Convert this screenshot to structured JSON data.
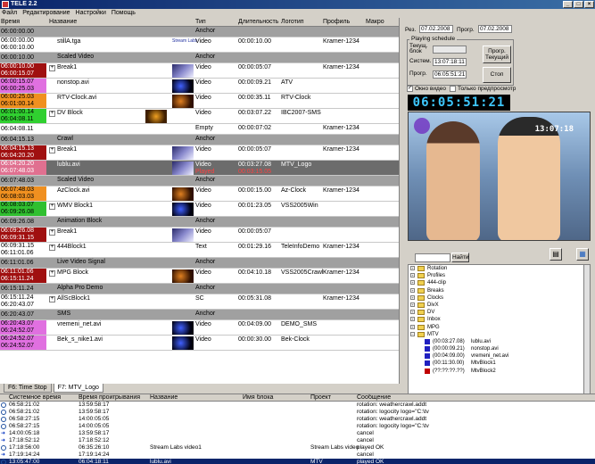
{
  "window": {
    "title": "TELE 2.2",
    "controls": [
      "_",
      "□",
      "×"
    ]
  },
  "menu": [
    "Файл",
    "Редактирование",
    "Настройки",
    "Помощь"
  ],
  "grid": {
    "headers": {
      "time": "Время",
      "name": "Название",
      "type": "Тип",
      "duration": "Длительность",
      "logo": "Логотип",
      "profile": "Профиль",
      "macro": "Макро"
    },
    "rows": [
      {
        "time": "06:00:00.00",
        "name": "",
        "type": "Anchor",
        "dur": "",
        "logo": "",
        "prof": "",
        "kind": "grp",
        "color": "#a0a0a0"
      },
      {
        "time": "06:00:00.00",
        "time2": "06:00:10.00",
        "name": "stillA.tga",
        "type": "Video",
        "dur": "00:00:10.00",
        "logo": "",
        "prof": "Kramer-1234",
        "color": "#ffffff",
        "thumb": "stream",
        "thumb_text": "Stream Labs",
        "tall": true
      },
      {
        "time": "06:00:10.00",
        "name": "Scaled Video",
        "type": "Anchor",
        "kind": "grp",
        "color": "#a0a0a0"
      },
      {
        "time": "06:00:10.00",
        "time2": "06:00:15.07",
        "name": "Break1",
        "type": "Video",
        "dur": "00:00:05:07",
        "logo": "",
        "prof": "Kramer-1234",
        "color": "#a01010",
        "thumb": "plain",
        "plus": true,
        "tall": true
      },
      {
        "time": "06:00:15.07",
        "time2": "06:00:25.03",
        "name": "nonstop.avi",
        "type": "Video",
        "dur": "00:00:09.21",
        "logo": "ATV",
        "prof": "",
        "color": "#e070e0",
        "thumb": "space",
        "tall": true
      },
      {
        "time": "06:00:25.03",
        "time2": "06:01:00.14",
        "name": "RTV-Clock.avi",
        "type": "Video",
        "dur": "00:00:35.11",
        "logo": "RTV-Clock",
        "prof": "",
        "color": "#f09020",
        "thumb": "dark",
        "tall": true
      },
      {
        "time": "06:01:00.14",
        "time2": "06:04:08.11",
        "name": "DV Block",
        "type": "Video",
        "dur": "00:03:07.22",
        "logo": "IBC2007-SMS",
        "prof": "",
        "color": "#30d030",
        "thumb": "fire",
        "plus": true,
        "tall": true
      },
      {
        "time": "06:04:08.11",
        "name": "",
        "type": "Empty",
        "dur": "00:00:07:02",
        "logo": "",
        "prof": "Kramer-1234",
        "color": "#ffffff"
      },
      {
        "time": "06:04:15.13",
        "name": "Crawl",
        "type": "Anchor",
        "kind": "grp",
        "color": "#a0a0a0"
      },
      {
        "time": "06:04:15.13",
        "time2": "06:04:20.20",
        "name": "Break1",
        "type": "Video",
        "dur": "00:00:05:07",
        "logo": "",
        "prof": "Kramer-1234",
        "color": "#a01010",
        "thumb": "plain",
        "plus": true,
        "tall": true
      },
      {
        "time": "06:04:20.20",
        "time2": "06:07:48.03",
        "name": "lublu.avi",
        "type": "Video",
        "dur": "00:03:27.08",
        "logo": "MTV_Logo",
        "prof": "",
        "color": "#e07090",
        "thumb": "plain",
        "kind": "sel",
        "tall": true,
        "sub": "Played",
        "sub2": "00:03:15.05"
      },
      {
        "time": "06:07:48.03",
        "name": "Scaled Video",
        "type": "Anchor",
        "kind": "grp",
        "color": "#a0a0a0"
      },
      {
        "time": "06:07:48.03",
        "time2": "06:08:03.03",
        "name": "AzClock.avi",
        "type": "Video",
        "dur": "00:00:15.00",
        "logo": "Az-Clock",
        "prof": "Kramer-1234",
        "color": "#f09020",
        "thumb": "dark",
        "tall": true
      },
      {
        "time": "06:08:03.07",
        "time2": "06:09:26.08",
        "name": "WMV Block1",
        "type": "Video",
        "dur": "00:01:23.05",
        "logo": "VSS2005Win",
        "prof": "",
        "color": "#30c030",
        "thumb": "space",
        "plus": true,
        "tall": true
      },
      {
        "time": "06:09:26.08",
        "name": "Animation Block",
        "type": "Anchor",
        "kind": "grp",
        "color": "#a0a0a0"
      },
      {
        "time": "06:09:26.08",
        "time2": "06:09:31.15",
        "name": "Break1",
        "type": "Video",
        "dur": "00:00:05:07",
        "logo": "",
        "prof": "",
        "color": "#a01010",
        "thumb": "plain",
        "plus": true,
        "tall": true
      },
      {
        "time": "06:09:31.15",
        "time2": "06:11:01.06",
        "name": "444Block1",
        "type": "Text",
        "dur": "00:01:29.16",
        "logo": "TeleInfoDemo",
        "prof": "Kramer-1234",
        "color": "#ffffff",
        "plus": true,
        "tall": true
      },
      {
        "time": "06:11:01.06",
        "name": "Live Video Signal",
        "type": "Anchor",
        "kind": "grp",
        "color": "#a0a0a0"
      },
      {
        "time": "06:11:01.06",
        "time2": "06:15:11.24",
        "name": "MPG Block",
        "type": "Video",
        "dur": "00:04:10.18",
        "logo": "VSS2005Crawl",
        "prof": "Kramer-1234",
        "color": "#a01010",
        "thumb": "dark",
        "plus": true,
        "tall": true
      },
      {
        "time": "06:15:11.24",
        "name": "Alpha Pro Demo",
        "type": "Anchor",
        "kind": "grp",
        "color": "#a0a0a0"
      },
      {
        "time": "06:15:11.24",
        "time2": "06:20:43.07",
        "name": "AllScBlock1",
        "type": "SC",
        "dur": "00:05:31.08",
        "logo": "",
        "prof": "Kramer-1234",
        "color": "#ffffff",
        "plus": true,
        "tall": true
      },
      {
        "time": "06:20:43.07",
        "name": "SMS",
        "type": "Anchor",
        "kind": "grp",
        "color": "#a0a0a0"
      },
      {
        "time": "06:20:43.07",
        "time2": "06:24:52.07",
        "name": "vremeni_net.avi",
        "type": "Video",
        "dur": "00:04:09.00",
        "logo": "DEMO_SMS",
        "prof": "",
        "color": "#e070e0",
        "thumb": "space",
        "tall": true
      },
      {
        "time": "06:24:52.07",
        "time2": "06:24:52.07",
        "name": "Bek_s_nike1.avi",
        "type": "Video",
        "dur": "00:00:30.00",
        "logo": "Bek-Clock",
        "prof": "",
        "color": "#e070e0",
        "thumb": "space",
        "tall": true
      }
    ]
  },
  "grid_tabs": [
    {
      "label": "F6:  Time Stop",
      "active": false
    },
    {
      "label": "F7:  MTV_Logo",
      "active": true
    }
  ],
  "right": {
    "rec_label": "Рез.",
    "rec_date": "07.02.2008",
    "prog_label": "Прогр.",
    "prog_date": "07.02.2008",
    "schedule_title": "Playing schedule",
    "current_block_label": "Текущ. блок",
    "system_label": "Систем.",
    "system_time": "13:07:18:11",
    "prog_time_label": "Прогр.",
    "prog_time": "06:05:51:21",
    "prog_current_btn": "Прогр. Текущий",
    "stop_btn": "Стоп",
    "video_window_label": "Окно видео",
    "preview_only_label": "Только предпросмотр",
    "clock": "06:05:51:21",
    "preview_stamp": "13:07:18",
    "search_btn": "Найти"
  },
  "tree": [
    {
      "type": "folder",
      "label": "Rotation"
    },
    {
      "type": "folder",
      "label": "Profiles"
    },
    {
      "type": "folder",
      "label": "444-clip"
    },
    {
      "type": "folder",
      "label": "Breaks"
    },
    {
      "type": "folder",
      "label": "Clocks"
    },
    {
      "type": "folder",
      "label": "DivX"
    },
    {
      "type": "folder",
      "label": "DV"
    },
    {
      "type": "folder",
      "label": "Inbox"
    },
    {
      "type": "folder",
      "label": "MPG"
    },
    {
      "type": "folder",
      "label": "MTV",
      "open": true
    },
    {
      "type": "clip",
      "time": "(00:03:27.08)",
      "name": "lublu.avi"
    },
    {
      "type": "clip",
      "time": "(00:00:09.21)",
      "name": "nonstop.avi"
    },
    {
      "type": "clip",
      "time": "(00:04:09.00)",
      "name": "vremeni_net.avi"
    },
    {
      "type": "clip",
      "time": "(00:11:30.00)",
      "name": "MtvBlock1"
    },
    {
      "type": "clip",
      "time": "(??:??:??.??)",
      "name": "MtvBlock2",
      "red": true
    }
  ],
  "log": {
    "headers": [
      "Системное время",
      "Время проигрывания",
      "Название",
      "Имя блока",
      "Проект",
      "Сообщение"
    ],
    "rows": [
      {
        "sys": "06:58:21:02",
        "play": "13:59:58:17",
        "name": "",
        "block": "",
        "proj": "",
        "msg": "rotation: weathercrawl.addt",
        "icon": "circle"
      },
      {
        "sys": "06:58:21:02",
        "play": "13:59:58:17",
        "name": "",
        "block": "",
        "proj": "",
        "msg": "rotation: logocity logo=\"C:\\tv",
        "icon": "circle"
      },
      {
        "sys": "06:58:27:15",
        "play": "14:00:05:05",
        "name": "",
        "block": "",
        "proj": "",
        "msg": "rotation: weathercrawl.addt",
        "icon": "circle"
      },
      {
        "sys": "06:58:27:15",
        "play": "14:00:05:05",
        "name": "",
        "block": "",
        "proj": "",
        "msg": "rotation: logocity logo=\"C:\\tv",
        "icon": "circle"
      },
      {
        "sys": "14:00:05:18",
        "play": "13:59:58:17",
        "name": "",
        "block": "",
        "proj": "",
        "msg": "cancel",
        "icon": "arrow"
      },
      {
        "sys": "17:18:52:12",
        "play": "17:18:52:12",
        "name": "",
        "block": "",
        "proj": "",
        "msg": "cancel",
        "icon": "arrow"
      },
      {
        "sys": "17:18:56:00",
        "play": "06:35:26:10",
        "name": "Stream Labs video1",
        "block": "",
        "proj": "Stream Labs video",
        "msg": "played OK",
        "icon": "circle"
      },
      {
        "sys": "17:19:14:24",
        "play": "17:19:14:24",
        "name": "",
        "block": "",
        "proj": "",
        "msg": "cancel",
        "icon": "arrow"
      },
      {
        "sys": "13:05:47:00",
        "play": "06:04:18:11",
        "name": "lublu.avi",
        "block": "",
        "proj": "MTV",
        "msg": "played OK",
        "icon": "circle",
        "sel": true
      }
    ]
  }
}
